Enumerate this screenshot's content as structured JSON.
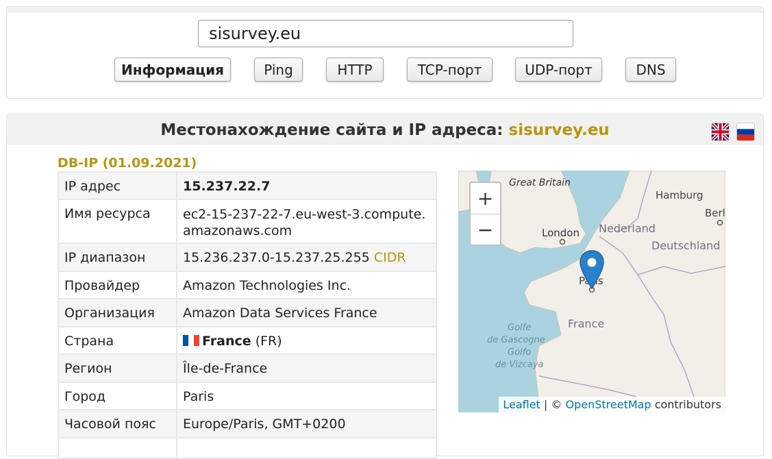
{
  "search": {
    "value": "sisurvey.eu"
  },
  "tabs": [
    {
      "label": "Информация",
      "active": true
    },
    {
      "label": "Ping"
    },
    {
      "label": "HTTP"
    },
    {
      "label": "TCP-порт"
    },
    {
      "label": "UDP-порт"
    },
    {
      "label": "DNS"
    }
  ],
  "heading": {
    "prefix": "Местонахождение сайта и IP адреса: ",
    "domain": "sisurvey.eu"
  },
  "source": "DB-IP (01.09.2021)",
  "rows": {
    "ip": {
      "label": "IP адрес",
      "value": "15.237.22.7"
    },
    "host": {
      "label": "Имя ресурса",
      "value": "ec2-15-237-22-7.eu-west-3.compute.amazonaws.com"
    },
    "range": {
      "label": "IP диапазон",
      "value": "15.236.237.0-15.237.25.255",
      "link": "CIDR"
    },
    "isp": {
      "label": "Провайдер",
      "value": "Amazon Technologies Inc."
    },
    "org": {
      "label": "Организация",
      "value": "Amazon Data Services France"
    },
    "country": {
      "label": "Страна",
      "name": "France",
      "code": "(FR)"
    },
    "region": {
      "label": "Регион",
      "value": "Île-de-France"
    },
    "city": {
      "label": "Город",
      "value": "Paris"
    },
    "tz": {
      "label": "Часовой пояс",
      "value": "Europe/Paris, GMT+0200"
    }
  },
  "map": {
    "zoom_in": "+",
    "zoom_out": "−",
    "labels": {
      "great_britain": "Great Britain",
      "hamburg": "Hamburg",
      "berlin": "Berl",
      "london": "London",
      "nederland": "Nederland",
      "deutschland": "Deutschland",
      "paris": "Paris",
      "france": "France",
      "golfe1": "Golfe",
      "golfe2": "de Gascogne",
      "golfe3": "Golfo",
      "golfe4": "de Vizcaya"
    },
    "attr_leaflet": "Leaflet",
    "attr_sep": " | © ",
    "attr_osm": "OpenStreetMap",
    "attr_tail": " contributors"
  },
  "colors": {
    "accent": "#b8960c",
    "link": "#0078a8",
    "water": "#aad3df",
    "land": "#f2efe9"
  }
}
